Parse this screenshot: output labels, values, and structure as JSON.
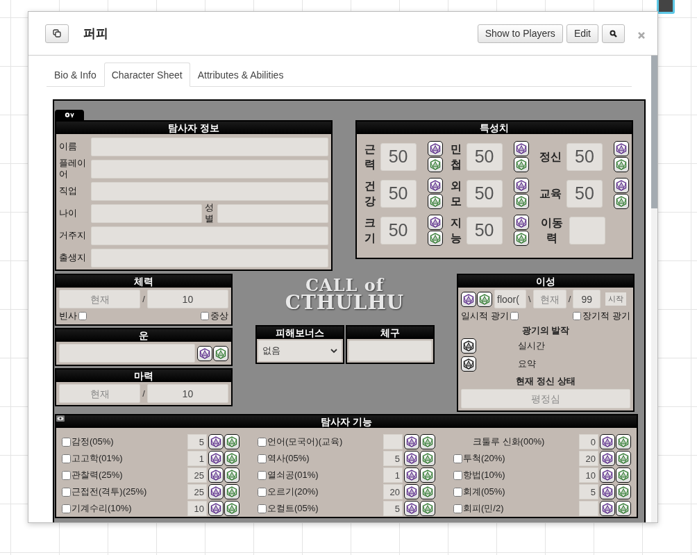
{
  "dialog": {
    "title": "퍼피",
    "buttons": [
      "Show to Players",
      "Edit"
    ]
  },
  "tabs": [
    {
      "label": "Bio & Info",
      "selected": false
    },
    {
      "label": "Character Sheet",
      "selected": true
    },
    {
      "label": "Attributes & Abilities",
      "selected": false
    }
  ],
  "investigator": {
    "title": "탐사자 정보",
    "fields": [
      {
        "kind": "single",
        "label": "이름"
      },
      {
        "kind": "single",
        "label": "플레이어"
      },
      {
        "kind": "single",
        "label": "직업"
      },
      {
        "kind": "pair",
        "label": "나이",
        "label2": "성별"
      },
      {
        "kind": "single",
        "label": "거주지"
      },
      {
        "kind": "single",
        "label": "출생지"
      }
    ]
  },
  "characteristics": {
    "title": "특성치",
    "items": [
      {
        "label": "근력",
        "value": "50",
        "dice": true
      },
      {
        "label": "민첩",
        "value": "50",
        "dice": true
      },
      {
        "label": "정신",
        "value": "50",
        "dice": true
      },
      {
        "label": "건강",
        "value": "50",
        "dice": true
      },
      {
        "label": "외모",
        "value": "50",
        "dice": true
      },
      {
        "label": "교육",
        "value": "50",
        "dice": true
      },
      {
        "label": "크기",
        "value": "50",
        "dice": true
      },
      {
        "label": "지능",
        "value": "50",
        "dice": true
      },
      {
        "label": "이동력",
        "dice": false
      }
    ]
  },
  "hp": {
    "title": "체력",
    "current_placeholder": "현재",
    "separator": "/",
    "max": "10",
    "checks": [
      {
        "label": "빈사",
        "checked": false
      },
      {
        "label": "중상",
        "checked": false
      }
    ]
  },
  "luck": {
    "title": "운"
  },
  "mp": {
    "title": "마력",
    "current_placeholder": "현재",
    "separator": "/",
    "max": "10"
  },
  "logo": {
    "line1": "CALL of",
    "line2": "CTHULHU"
  },
  "damage_bonus": {
    "title": "피해보너스",
    "value": "없음"
  },
  "build": {
    "title": "체구"
  },
  "sanity": {
    "title": "이성",
    "formula": "floor(",
    "separator1": "\\",
    "current_placeholder": "현재",
    "separator2": "/",
    "max": "99",
    "start": "시작",
    "temporary": {
      "label": "일시적 광기",
      "checked": false
    },
    "indefinite": {
      "label": "장기적 광기",
      "checked": false
    },
    "bouts_title": "광기의 발작",
    "bouts": [
      "실시간",
      "요약"
    ],
    "state_title": "현재 정신 상태",
    "state_placeholder": "평정심"
  },
  "skills": {
    "title": "탐사자 기능",
    "columns": [
      [
        {
          "kind": "check",
          "label": "감정(05%)",
          "checked": false,
          "value": "5"
        },
        {
          "kind": "check",
          "label": "고고학(01%)",
          "checked": false,
          "value": "1"
        },
        {
          "kind": "check",
          "label": "관찰력(25%)",
          "checked": false,
          "value": "25"
        },
        {
          "kind": "check",
          "label": "근접전(격투)(25%)",
          "checked": false,
          "value": "25"
        },
        {
          "kind": "check",
          "label": "기계수리(10%)",
          "checked": false,
          "value": "10"
        }
      ],
      [
        {
          "kind": "check",
          "label": "언어(모국어)(교육)",
          "checked": false
        },
        {
          "kind": "check",
          "label": "역사(05%)",
          "checked": false,
          "value": "5"
        },
        {
          "kind": "check",
          "label": "열쇠공(01%)",
          "checked": false,
          "value": "1"
        },
        {
          "kind": "check",
          "label": "오르기(20%)",
          "checked": false,
          "value": "20"
        },
        {
          "kind": "check",
          "label": "오컬트(05%)",
          "checked": false,
          "value": "5"
        }
      ],
      [
        {
          "kind": "plain",
          "label": "크툴루 신화(00%)",
          "value": "0"
        },
        {
          "kind": "check",
          "label": "투척(20%)",
          "checked": false,
          "value": "20"
        },
        {
          "kind": "check",
          "label": "항법(10%)",
          "checked": false,
          "value": "10"
        },
        {
          "kind": "check",
          "label": "회계(05%)",
          "checked": false,
          "value": "5"
        },
        {
          "kind": "check",
          "label": "회피(민/2)",
          "checked": false
        }
      ]
    ]
  }
}
